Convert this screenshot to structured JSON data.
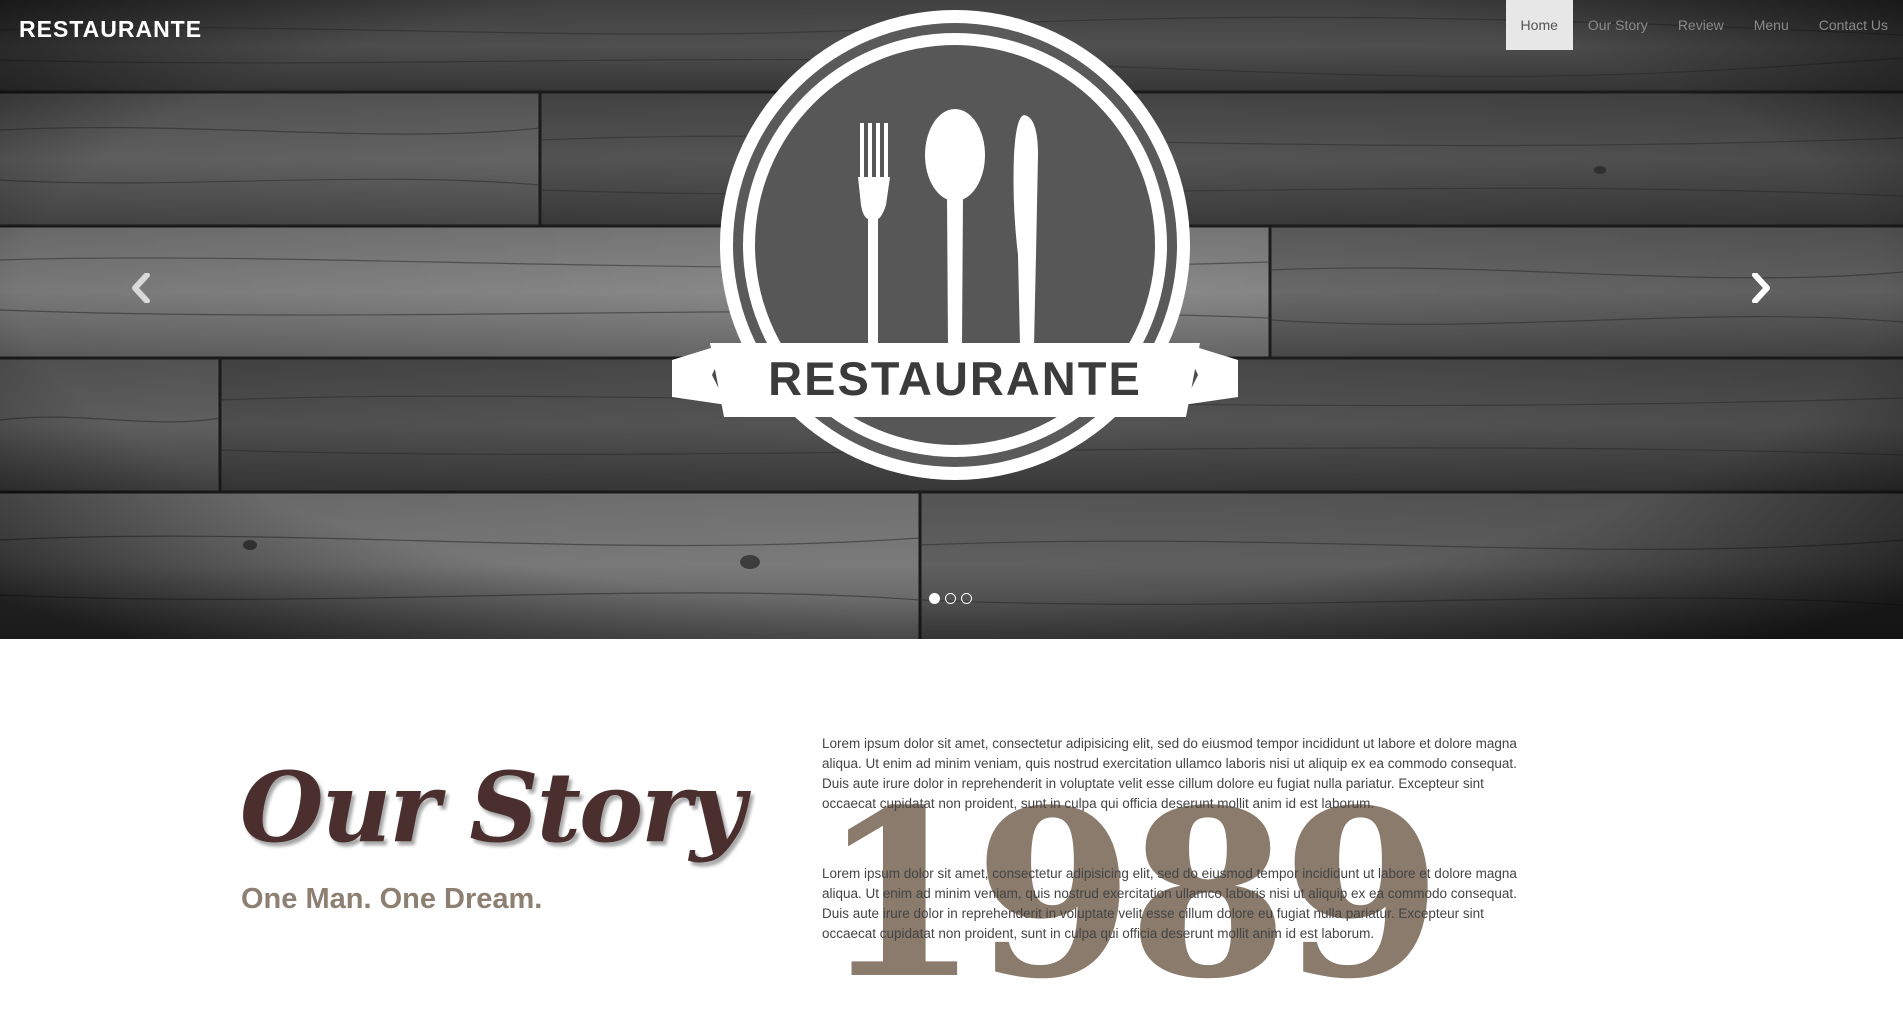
{
  "brand": {
    "name": "RESTAURANTE"
  },
  "nav": {
    "items": [
      {
        "label": "Home",
        "active": true
      },
      {
        "label": "Our Story",
        "active": false
      },
      {
        "label": "Review",
        "active": false
      },
      {
        "label": "Menu",
        "active": false
      },
      {
        "label": "Contact Us",
        "active": false
      }
    ]
  },
  "hero": {
    "emblem_text": "RESTAURANTE",
    "controls": {
      "prev_icon": "chevron-left-icon",
      "next_icon": "chevron-right-icon"
    },
    "slides_total": 3,
    "active_slide": 1
  },
  "story": {
    "title": "Our Story",
    "subtitle": "One Man. One Dream.",
    "year": "1989",
    "paragraph1": "Lorem ipsum dolor sit amet, consectetur adipisicing elit, sed do eiusmod tempor incididunt ut labore et dolore magna aliqua. Ut enim ad minim veniam, quis nostrud exercitation ullamco laboris nisi ut aliquip ex ea commodo consequat. Duis aute irure dolor in reprehenderit in voluptate velit esse cillum dolore eu fugiat nulla pariatur. Excepteur sint occaecat cupidatat non proident, sunt in culpa qui officia deserunt mollit anim id est laborum.",
    "paragraph2": "Lorem ipsum dolor sit amet, consectetur adipisicing elit, sed do eiusmod tempor incididunt ut labore et dolore magna aliqua. Ut enim ad minim veniam, quis nostrud exercitation ullamco laboris nisi ut aliquip ex ea commodo consequat. Duis aute irure dolor in reprehenderit in voluptate velit esse cillum dolore eu fugiat nulla pariatur. Excepteur sint occaecat cupidatat non proident, sunt in culpa qui officia deserunt mollit anim id est laborum."
  },
  "colors": {
    "story_title": "#4a2f2e",
    "story_subtitle": "#8d7f72",
    "year": "#8a7b6c",
    "nav_active_bg": "#e7e7e7"
  }
}
